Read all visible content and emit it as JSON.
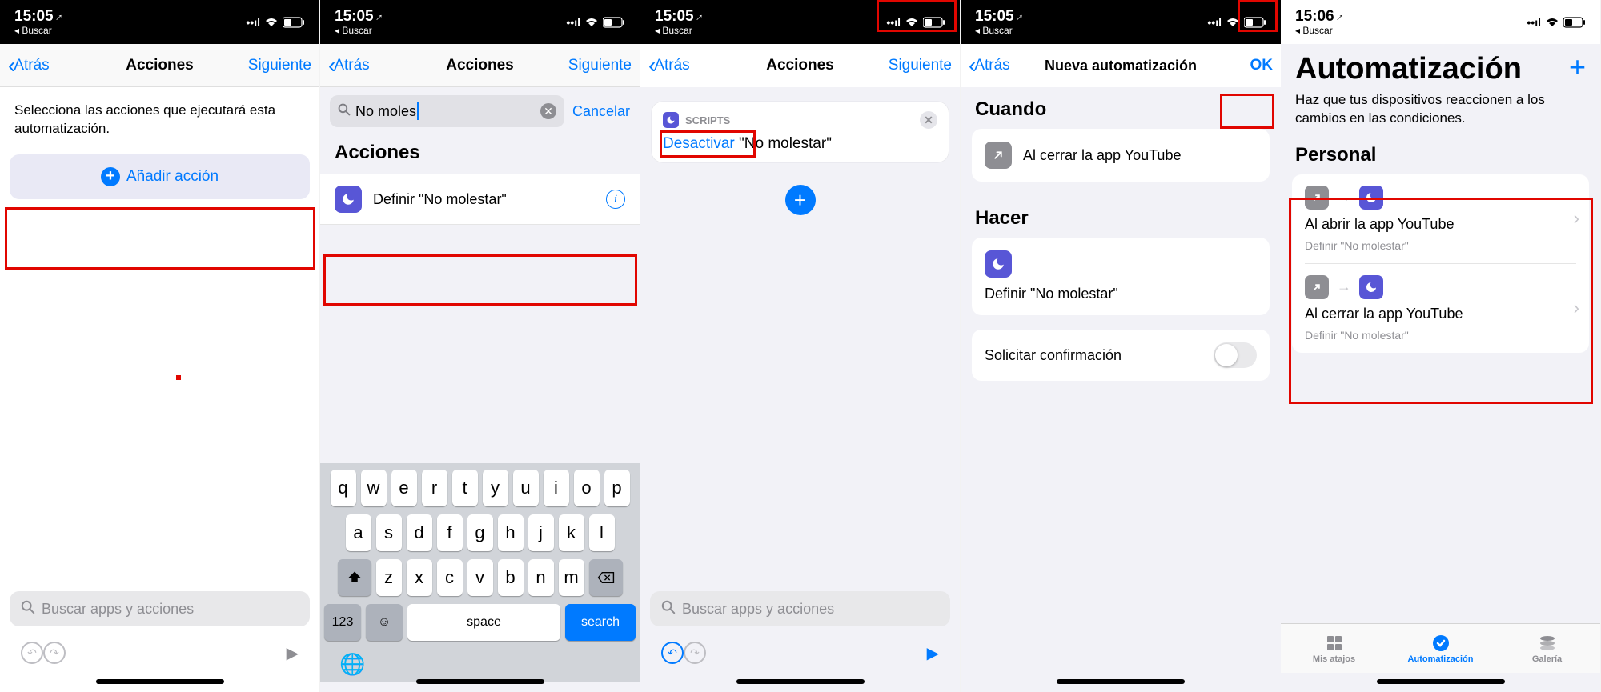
{
  "status": {
    "time1": "15:05",
    "time5": "15:06",
    "back": "Buscar",
    "signal": "••ıl",
    "wifi": "wifi"
  },
  "s1": {
    "back": "Atrás",
    "title": "Acciones",
    "next": "Siguiente",
    "instruction": "Selecciona las acciones que ejecutará esta automatización.",
    "add": "Añadir acción",
    "search_ph": "Buscar apps y acciones"
  },
  "s2": {
    "back": "Atrás",
    "title": "Acciones",
    "next": "Siguiente",
    "query": "No moles",
    "cancel": "Cancelar",
    "section": "Acciones",
    "action": "Definir \"No molestar\"",
    "kb": {
      "r1": [
        "q",
        "w",
        "e",
        "r",
        "t",
        "y",
        "u",
        "i",
        "o",
        "p"
      ],
      "r2": [
        "a",
        "s",
        "d",
        "f",
        "g",
        "h",
        "j",
        "k",
        "l"
      ],
      "r3": [
        "z",
        "x",
        "c",
        "v",
        "b",
        "n",
        "m"
      ],
      "num": "123",
      "space": "space",
      "search": "search"
    }
  },
  "s3": {
    "back": "Atrás",
    "title": "Acciones",
    "next": "Siguiente",
    "card_head": "SCRIPTS",
    "card_link": "Desactivar",
    "card_text": " \"No molestar\"",
    "search_ph": "Buscar apps y acciones"
  },
  "s4": {
    "back": "Atrás",
    "title": "Nueva automatización",
    "ok": "OK",
    "when": "Cuando",
    "when_text": "Al cerrar la app YouTube",
    "do": "Hacer",
    "do_text": "Definir \"No molestar\"",
    "confirm": "Solicitar confirmación"
  },
  "s5": {
    "big": "Automatización",
    "sub": "Haz que tus dispositivos reaccionen a los cambios en las condiciones.",
    "personal": "Personal",
    "items": [
      {
        "title": "Al abrir la app YouTube",
        "sub": "Definir \"No molestar\""
      },
      {
        "title": "Al cerrar la app YouTube",
        "sub": "Definir \"No molestar\""
      }
    ],
    "tabs": {
      "shortcuts": "Mis atajos",
      "automation": "Automatización",
      "gallery": "Galería"
    }
  }
}
